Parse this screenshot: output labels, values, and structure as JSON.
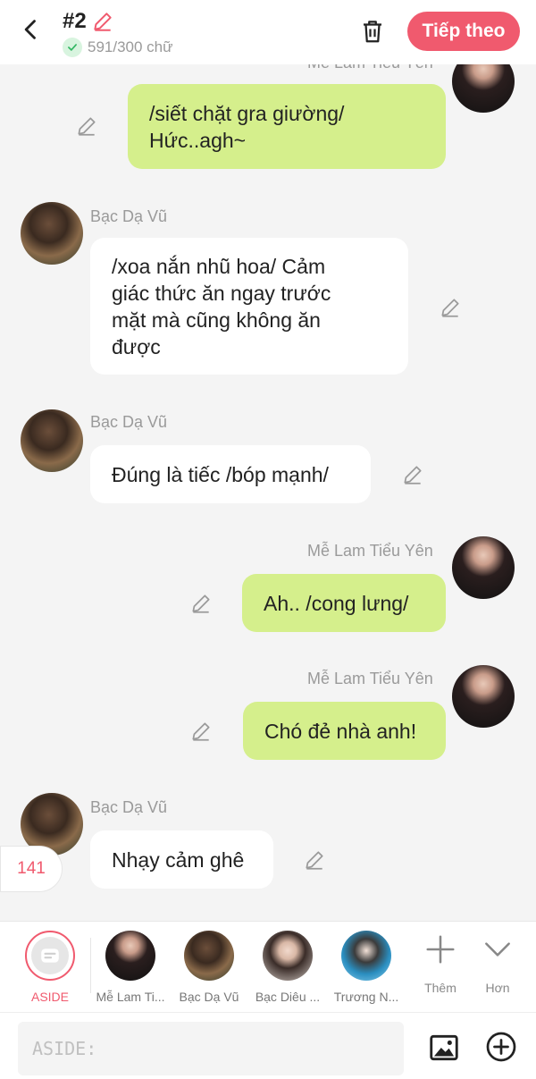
{
  "header": {
    "title": "#2",
    "word_count": "591/300 chữ",
    "next_label": "Tiếp theo"
  },
  "chat": {
    "cutoff_sender": "Mễ Lam Tiểu Yên",
    "messages": [
      {
        "sender": "",
        "text_lines": [
          "/siết chặt gra giường/",
          "Hức..agh~"
        ],
        "side": "right"
      },
      {
        "sender": "Bạc Dạ Vũ",
        "text_lines": [
          "/xoa nắn nhũ hoa/ Cảm",
          "giác thức ăn ngay trước",
          "mặt mà cũng không ăn",
          "được"
        ],
        "side": "left"
      },
      {
        "sender": "Bạc Dạ Vũ",
        "text_lines": [
          "Đúng là tiếc /bóp mạnh/"
        ],
        "side": "left"
      },
      {
        "sender": "Mễ Lam Tiểu Yên",
        "text_lines": [
          "Ah.. /cong lưng/"
        ],
        "side": "right"
      },
      {
        "sender": "Mễ Lam Tiểu Yên",
        "text_lines": [
          "Chó đẻ nhà anh!"
        ],
        "side": "right"
      },
      {
        "sender": "Bạc Dạ Vũ",
        "text_lines": [
          "Nhạy cảm ghê"
        ],
        "side": "left"
      }
    ],
    "counter": "141"
  },
  "characters": {
    "aside_label": "ASIDE",
    "items": [
      {
        "label": "Mễ Lam Ti..."
      },
      {
        "label": "Bạc Dạ Vũ"
      },
      {
        "label": "Bạc Diêu ..."
      },
      {
        "label": "Trương N..."
      }
    ],
    "more_label": "Thêm",
    "expand_label": "Hơn"
  },
  "input": {
    "placeholder": "ASIDE:"
  },
  "colors": {
    "accent": "#f05a6e",
    "bubble_right": "#d5ef8c",
    "bubble_left": "#ffffff",
    "background": "#f4f4f4"
  }
}
